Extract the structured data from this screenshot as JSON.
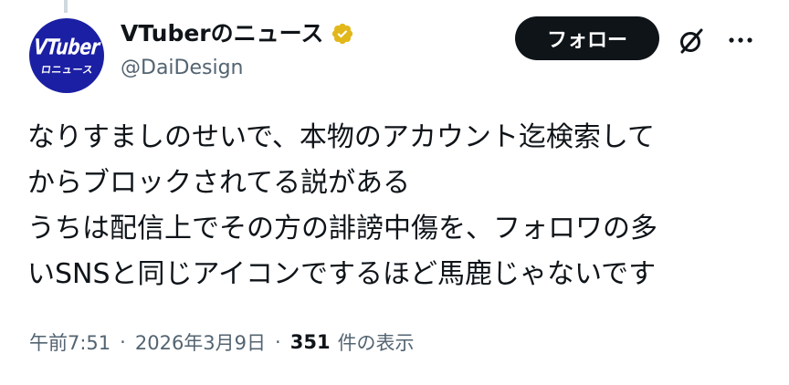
{
  "avatar": {
    "line1": "VTuber",
    "line2": "ロニュース"
  },
  "author": {
    "display_name": "VTuberのニュース",
    "handle": "@DaiDesign",
    "verified_icon": "verified-badge-icon"
  },
  "actions": {
    "follow_label": "フォロー",
    "grok_icon": "grok-icon",
    "more_icon": "more-icon"
  },
  "tweet": {
    "lines": [
      "なりすましのせいで、本物のアカウント迄検索して",
      "からブロックされてる説がある",
      "うちは配信上でその方の誹謗中傷を、フォロワの多",
      "いSNSと同じアイコンでするほど馬鹿じゃないです"
    ]
  },
  "meta": {
    "time": "午前7:51",
    "date": "2026年3月9日",
    "views_count": "351",
    "views_label": "件の表示",
    "separator": "·"
  },
  "colors": {
    "text_primary": "#0f1419",
    "text_secondary": "#536471",
    "avatar_bg": "#1b1fa3",
    "badge_gold": "#e2b719",
    "button_bg": "#0f1419"
  }
}
